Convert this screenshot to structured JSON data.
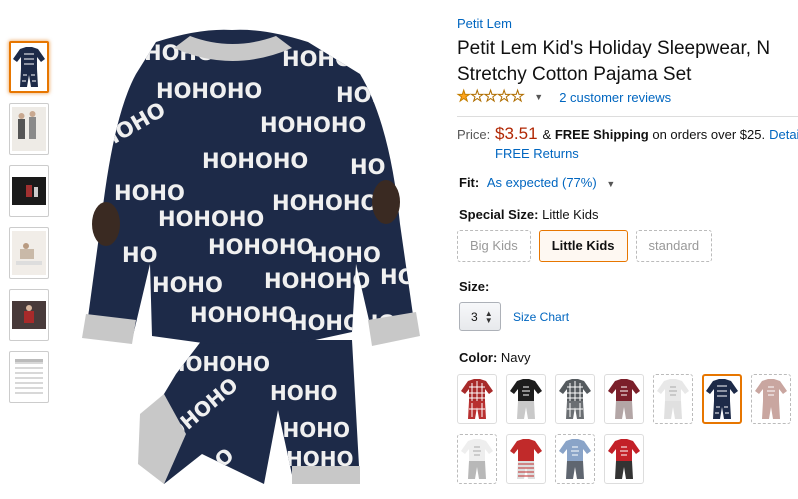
{
  "product": {
    "brand": "Petit Lem",
    "title_line1": "Petit Lem Kid's Holiday Sleepwear, N",
    "title_line2": "Stretchy Cotton Pajama Set",
    "rating": {
      "stars": 1,
      "reviews": "2 customer reviews"
    },
    "price": {
      "label": "Price:",
      "value": "$3.51",
      "shipping_prefix": "&",
      "shipping_bold": "FREE Shipping",
      "shipping_suffix": "on orders over $25.",
      "details_link": "Detail",
      "returns": "FREE Returns"
    },
    "fit": {
      "label": "Fit:",
      "value": "As expected (77%)"
    },
    "special_size": {
      "label": "Special Size:",
      "selected": "Little Kids",
      "options": [
        "Big Kids",
        "Little Kids",
        "standard"
      ]
    },
    "size": {
      "label": "Size:",
      "selected": "3",
      "chart_link": "Size Chart"
    },
    "color": {
      "label": "Color:",
      "selected": "Navy",
      "swatches": [
        {
          "name": "red-plaid",
          "top": "#a82a2a",
          "bottom": "#b83030",
          "pattern": "plaid",
          "available": true
        },
        {
          "name": "black-polar-bear",
          "top": "#1d1d1d",
          "bottom": "#c9c9c9",
          "pattern": "print",
          "available": true
        },
        {
          "name": "gray-plaid",
          "top": "#555a5e",
          "bottom": "#6a6e72",
          "pattern": "plaid",
          "available": true
        },
        {
          "name": "burgundy-script",
          "top": "#7b1f2a",
          "bottom": "#b3a6a6",
          "pattern": "print",
          "available": true
        },
        {
          "name": "white-fair-isle",
          "top": "#e8e8e8",
          "bottom": "#e0e0e0",
          "pattern": "print",
          "available": false
        },
        {
          "name": "navy",
          "top": "#1d2a48",
          "bottom": "#1d2a48",
          "pattern": "hoho",
          "available": true
        },
        {
          "name": "pink-print",
          "top": "#c9a6a0",
          "bottom": "#c9a6a0",
          "pattern": "print",
          "available": false
        },
        {
          "name": "white-snowman",
          "top": "#eeeeee",
          "bottom": "#b8b8b8",
          "pattern": "print",
          "available": false
        },
        {
          "name": "red-santa-stripe",
          "top": "#c12a2a",
          "bottom": "#ddd",
          "pattern": "stripe",
          "available": true
        },
        {
          "name": "light-blue-print",
          "top": "#8aa4c8",
          "bottom": "#5f6670",
          "pattern": "print",
          "available": false
        },
        {
          "name": "red-penguin",
          "top": "#c32028",
          "bottom": "#333",
          "pattern": "print",
          "available": true
        }
      ]
    }
  },
  "thumbnails": [
    {
      "name": "navy-pajama-front",
      "color": "#1d2a48"
    },
    {
      "name": "kids-photo",
      "color": "#bfb8b0"
    },
    {
      "name": "video-dark",
      "color": "#222222"
    },
    {
      "name": "kids-floor-photo",
      "color": "#d8cfc4"
    },
    {
      "name": "video-red",
      "color": "#2a1a1a"
    },
    {
      "name": "size-chart-table",
      "color": "#ffffff"
    }
  ]
}
